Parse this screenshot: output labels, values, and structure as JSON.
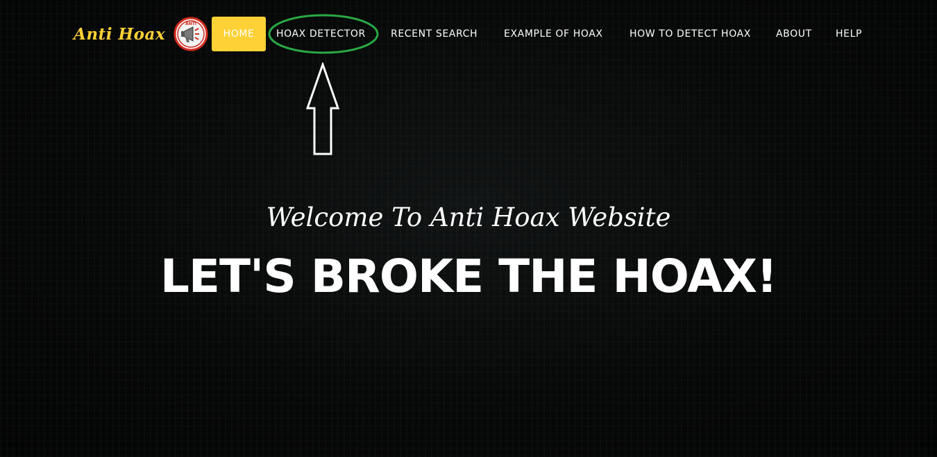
{
  "brand": {
    "name": "Anti Hoax",
    "logo_text": "ANTI",
    "logo_icon": "megaphone-icon"
  },
  "nav": {
    "items": [
      {
        "label": "HOME",
        "active": true
      },
      {
        "label": "HOAX DETECTOR",
        "active": false
      },
      {
        "label": "RECENT SEARCH",
        "active": false
      },
      {
        "label": "EXAMPLE OF HOAX",
        "active": false
      },
      {
        "label": "HOW TO DETECT HOAX",
        "active": false
      },
      {
        "label": "ABOUT",
        "active": false
      },
      {
        "label": "HELP",
        "active": false
      }
    ]
  },
  "hero": {
    "subtitle": "Welcome To Anti Hoax Website",
    "title": "LET'S BROKE THE HOAX!"
  },
  "annotation": {
    "highlight_color": "#2aa845",
    "arrow_color": "#ffffff"
  },
  "colors": {
    "accent": "#fed136",
    "background": "#050606",
    "text": "#ffffff"
  }
}
